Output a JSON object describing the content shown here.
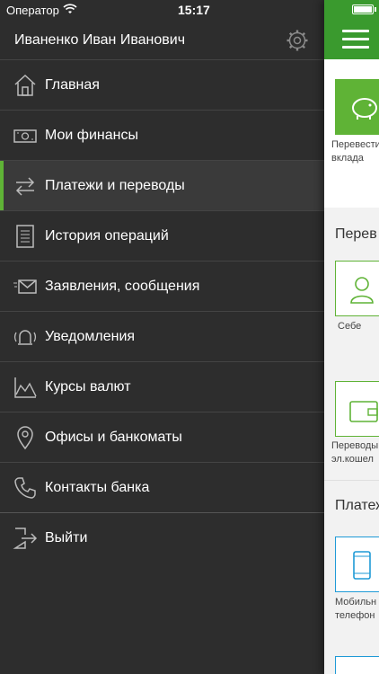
{
  "status": {
    "carrier": "Оператор",
    "time": "15:17"
  },
  "user": {
    "name": "Иваненко Иван Иванович"
  },
  "menu": [
    {
      "label": "Главная",
      "icon": "home-icon"
    },
    {
      "label": "Мои финансы",
      "icon": "money-icon"
    },
    {
      "label": "Платежи и переводы",
      "icon": "transfer-arrows-icon",
      "active": true
    },
    {
      "label": "История операций",
      "icon": "history-list-icon"
    },
    {
      "label": "Заявления, сообщения",
      "icon": "envelope-icon"
    },
    {
      "label": "Уведомления",
      "icon": "bell-icon"
    },
    {
      "label": "Курсы валют",
      "icon": "chart-icon"
    },
    {
      "label": "Офисы и банкоматы",
      "icon": "location-pin-icon"
    },
    {
      "label": "Контакты банка",
      "icon": "phone-icon"
    }
  ],
  "logout": {
    "label": "Выйти",
    "icon": "logout-icon"
  },
  "content": {
    "tile1_label": "Перевести вклада",
    "section1": "Перев",
    "tile2_label": "Себе",
    "tile3_label": "Переводы эл.кошел",
    "section2": "Платеж",
    "tile4_label": "Мобильн телефон"
  },
  "colors": {
    "accent": "#5fb336",
    "header": "#3a9a2e",
    "drawer": "#2d2d2d",
    "blue": "#1e9ad6"
  }
}
